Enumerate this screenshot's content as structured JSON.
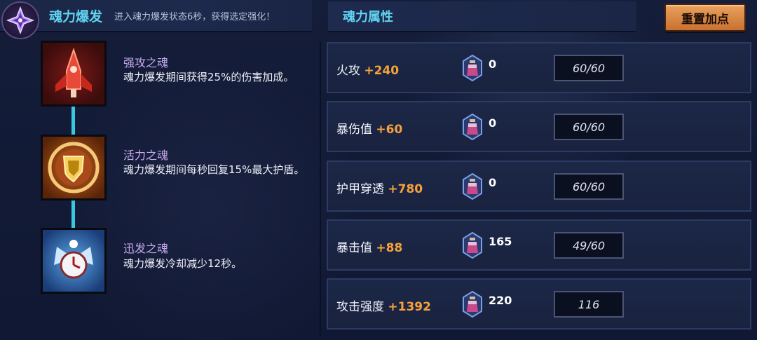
{
  "soul_burst": {
    "title": "魂力爆发",
    "description": "进入魂力爆发状态6秒，获得选定强化！",
    "emblem_icon": "purple-crystal-emblem-icon",
    "skills": [
      {
        "name": "强攻之魂",
        "text": "魂力爆发期间获得25%的伤害加成。",
        "icon": "red-rocket-icon"
      },
      {
        "name": "活力之魂",
        "text": "魂力爆发期间每秒回复15%最大护盾。",
        "icon": "golden-shield-icon"
      },
      {
        "name": "迅发之魂",
        "text": "魂力爆发冷却减少12秒。",
        "icon": "blue-winged-clock-icon"
      }
    ]
  },
  "attributes": {
    "title": "魂力属性",
    "reset_label": "重置加点",
    "rows": [
      {
        "name": "火攻",
        "bonus": "+240",
        "count": "0",
        "progress": "60/60"
      },
      {
        "name": "暴伤值",
        "bonus": "+60",
        "count": "0",
        "progress": "60/60"
      },
      {
        "name": "护甲穿透",
        "bonus": "+780",
        "count": "0",
        "progress": "60/60"
      },
      {
        "name": "暴击值",
        "bonus": "+88",
        "count": "165",
        "progress": "49/60"
      },
      {
        "name": "攻击强度",
        "bonus": "+1392",
        "count": "220",
        "progress": "116"
      }
    ]
  },
  "colors": {
    "title_cyan": "#5fd3f0",
    "skill_name_purple": "#c7a9ee",
    "bonus_orange": "#f6a23a",
    "button_orange": "#e9a25e"
  }
}
